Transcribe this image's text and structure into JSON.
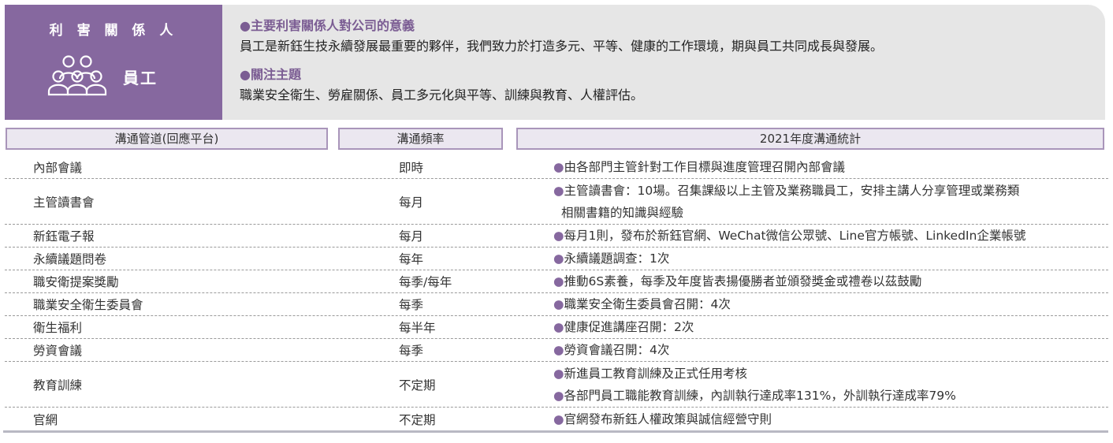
{
  "stakeholder": {
    "title": "利 害 關 係 人",
    "name": "員工",
    "icon": "people-group-icon"
  },
  "topics": [
    {
      "heading": "主要利害關係人對公司的意義",
      "body": "員工是新鈺生技永續發展最重要的夥伴，我們致力於打造多元、平等、健康的工作環境，期與員工共同成長與發展。"
    },
    {
      "heading": "關注主題",
      "body": "職業安全衛生、勞雇關係、員工多元化與平等、訓練與教育、人權評估。"
    }
  ],
  "table": {
    "headers": {
      "channel": "溝通管道(回應平台)",
      "frequency": "溝通頻率",
      "stats": "2021年度溝通統計"
    },
    "rows": [
      {
        "channel": "內部會議",
        "frequency": "即時",
        "stats": [
          "由各部門主管針對工作目標與進度管理召開內部會議"
        ]
      },
      {
        "channel": "主管讀書會",
        "frequency": "每月",
        "stats": [
          "主管讀書會：10場。召集課級以上主管及業務職員工，安排主講人分享管理或業務類",
          "相關書籍的知識與經驗"
        ]
      },
      {
        "channel": "新鈺電子報",
        "frequency": "每月",
        "stats": [
          "每月1則，發布於新鈺官網、WeChat微信公眾號、Line官方帳號、LinkedIn企業帳號"
        ]
      },
      {
        "channel": "永續議題問卷",
        "frequency": "每年",
        "stats": [
          "永續議題調查：1次"
        ]
      },
      {
        "channel": "職安衛提案獎勵",
        "frequency": "每季/每年",
        "stats": [
          "推動6S素養，每季及年度皆表揚優勝者並頒發獎金或禮卷以茲鼓勵"
        ]
      },
      {
        "channel": "職業安全衛生委員會",
        "frequency": "每季",
        "stats": [
          "職業安全衛生委員會召開：4次"
        ]
      },
      {
        "channel": "衛生福利",
        "frequency": "每半年",
        "stats": [
          "健康促進講座召開：2次"
        ]
      },
      {
        "channel": "勞資會議",
        "frequency": "每季",
        "stats": [
          "勞資會議召開：4次"
        ]
      },
      {
        "channel": "教育訓練",
        "frequency": "不定期",
        "stats": [
          "新進員工教育訓練及正式任用考核",
          "各部門員工職能教育訓練，內訓執行達成率131%，外訓執行達成率79%"
        ]
      },
      {
        "channel": "官網",
        "frequency": "不定期",
        "stats": [
          "官網發布新鈺人權政策與誠信經營守則"
        ]
      }
    ]
  },
  "colors": {
    "accent": "#86689f",
    "banner_bg": "#e6e6e6",
    "header_border": "#a995ba",
    "header_bg": "#ebe7f0"
  }
}
